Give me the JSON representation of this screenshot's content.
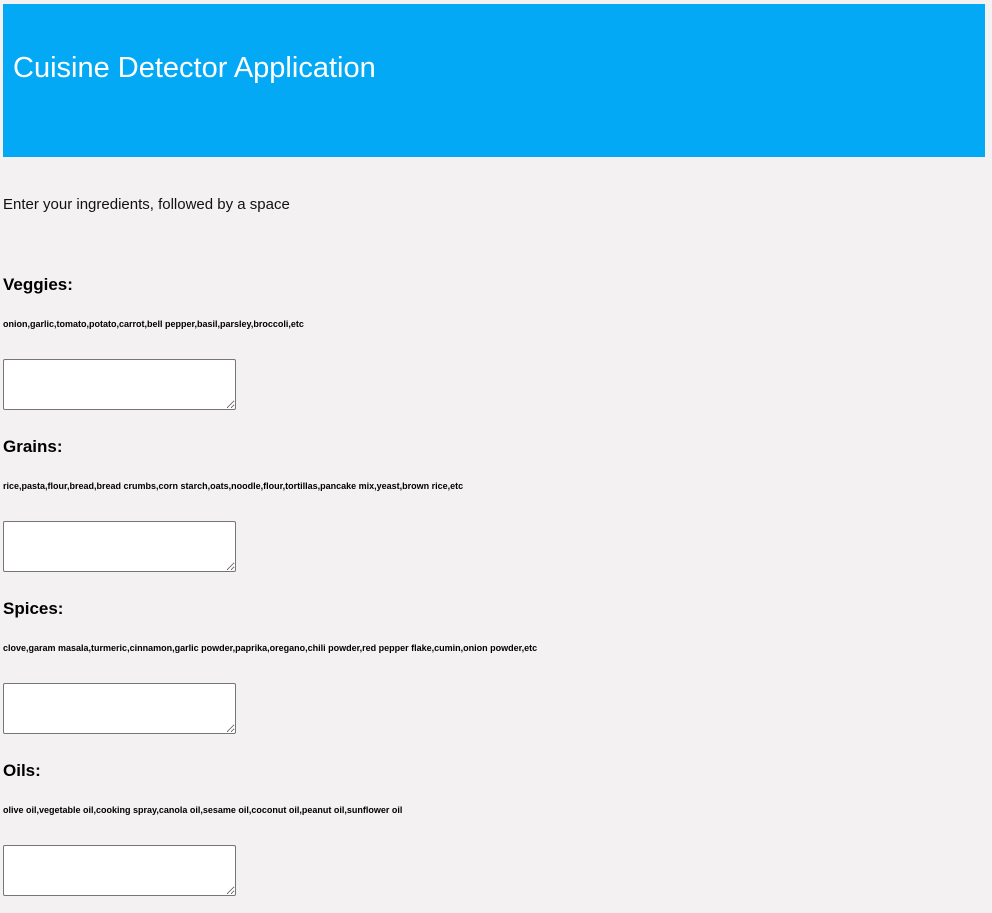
{
  "header": {
    "title": "Cuisine Detector Application",
    "background_color": "#03a9f4",
    "text_color": "#ffffff"
  },
  "page": {
    "background_color": "#f3f1f2"
  },
  "intro": {
    "text": "Enter your ingredients, followed by a space"
  },
  "sections": [
    {
      "heading": "Veggies:",
      "examples": "onion,garlic,tomato,potato,carrot,bell pepper,basil,parsley,broccoli,etc",
      "input_value": ""
    },
    {
      "heading": "Grains:",
      "examples": "rice,pasta,flour,bread,bread crumbs,corn starch,oats,noodle,flour,tortillas,pancake mix,yeast,brown rice,etc",
      "input_value": ""
    },
    {
      "heading": "Spices:",
      "examples": "clove,garam masala,turmeric,cinnamon,garlic powder,paprika,oregano,chili powder,red pepper flake,cumin,onion powder,etc",
      "input_value": ""
    },
    {
      "heading": "Oils:",
      "examples": "olive oil,vegetable oil,cooking spray,canola oil,sesame oil,coconut oil,peanut oil,sunflower oil",
      "input_value": ""
    }
  ]
}
